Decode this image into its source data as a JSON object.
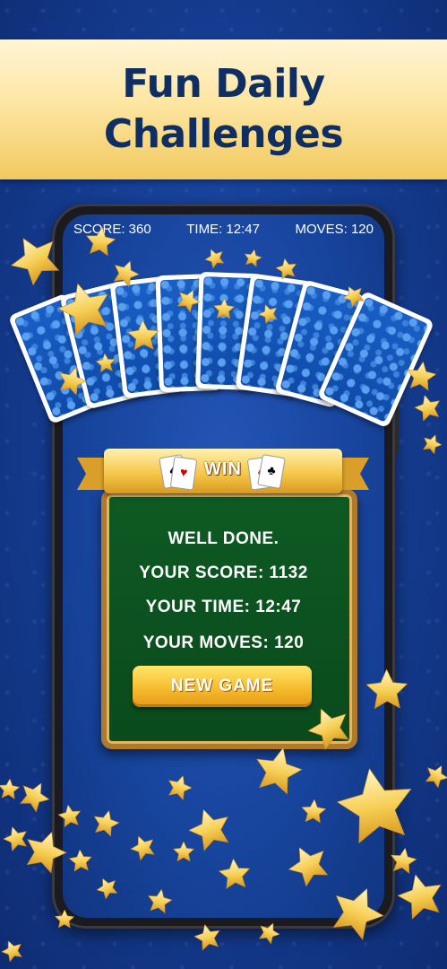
{
  "banner": {
    "line1": "Fun Daily",
    "line2": "Challenges"
  },
  "status": {
    "score": "SCORE: 360",
    "time": "TIME: 12:47",
    "moves": "MOVES: 120"
  },
  "win_dialog": {
    "title": "WIN",
    "message": "WELL DONE.",
    "score": "YOUR SCORE: 1132",
    "time": "YOUR TIME: 12:47",
    "moves": "YOUR MOVES: 120",
    "new_game_label": "NEW GAME"
  },
  "colors": {
    "background": "#163f96",
    "banner_text": "#0f2f63",
    "felt": "#0e5a23",
    "gold": "#f5b82a"
  },
  "icons": [
    "star-icon",
    "playing-card-icon"
  ]
}
